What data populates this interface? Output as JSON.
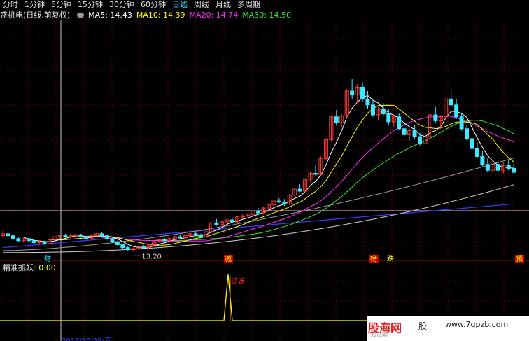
{
  "tabs": [
    "分时",
    "1分钟",
    "5分钟",
    "15分钟",
    "30分钟",
    "60分钟",
    "日线",
    "周线",
    "月线",
    "多周期"
  ],
  "active_tab": 6,
  "stock_title": "盛机电(日线,前复权)",
  "ma": {
    "ma5_label": "MA5:",
    "ma5_value": "14.43",
    "ma5_color": "#ffffff",
    "ma10_label": "MA10:",
    "ma10_value": "14.39",
    "ma10_color": "#ffff00",
    "ma20_label": "MA20:",
    "ma20_value": "14.74",
    "ma20_color": "#ff2cff",
    "ma30_label": "MA30:",
    "ma30_value": "14.50",
    "ma30_color": "#31e831"
  },
  "price_low_label": "13.20",
  "markers": [
    "财",
    "减",
    "榜",
    "跌",
    "预"
  ],
  "indicator": {
    "name": "精准抓妖",
    "value": ": 0.00",
    "signal_label": "抓妖"
  },
  "watermark": {
    "brand": "股海网",
    "brand2": "股",
    "url": "www.7gpzb.com",
    "sub": "股海网",
    "date": "2016/10/28/五"
  },
  "colors": {
    "up": "#ff3b3b",
    "down": "#3ee8ff",
    "grid": "#7a0000",
    "crosshair": "#c8c8c8"
  },
  "chart_data": {
    "type": "candlestick",
    "candles": [
      [
        14.8,
        15.3,
        14.6,
        15.0
      ],
      [
        15.0,
        15.2,
        14.7,
        14.8
      ],
      [
        14.8,
        14.9,
        14.4,
        14.5
      ],
      [
        14.5,
        14.7,
        14.2,
        14.3
      ],
      [
        14.3,
        14.6,
        14.1,
        14.5
      ],
      [
        14.5,
        14.6,
        14.2,
        14.3
      ],
      [
        14.3,
        14.4,
        14.0,
        14.1
      ],
      [
        14.1,
        14.3,
        13.9,
        14.2
      ],
      [
        14.2,
        14.3,
        13.9,
        14.0
      ],
      [
        14.0,
        14.5,
        13.9,
        14.4
      ],
      [
        14.4,
        14.8,
        14.3,
        14.7
      ],
      [
        14.7,
        14.9,
        14.5,
        14.8
      ],
      [
        14.8,
        15.0,
        14.6,
        14.7
      ],
      [
        14.7,
        14.9,
        14.5,
        14.8
      ],
      [
        14.8,
        15.0,
        14.6,
        14.9
      ],
      [
        14.9,
        15.0,
        14.6,
        14.7
      ],
      [
        14.7,
        14.8,
        14.4,
        14.5
      ],
      [
        14.5,
        14.9,
        14.4,
        14.8
      ],
      [
        14.8,
        15.1,
        14.7,
        15.0
      ],
      [
        15.0,
        15.2,
        14.7,
        14.8
      ],
      [
        14.8,
        14.9,
        14.4,
        14.5
      ],
      [
        14.5,
        14.6,
        14.1,
        14.2
      ],
      [
        14.2,
        14.3,
        13.8,
        13.9
      ],
      [
        13.9,
        14.0,
        13.5,
        13.6
      ],
      [
        13.6,
        13.8,
        13.3,
        13.4
      ],
      [
        13.4,
        13.6,
        13.2,
        13.5
      ],
      [
        13.5,
        13.8,
        13.4,
        13.7
      ],
      [
        13.7,
        13.9,
        13.5,
        13.6
      ],
      [
        13.6,
        14.0,
        13.5,
        13.9
      ],
      [
        13.9,
        14.3,
        13.8,
        14.2
      ],
      [
        14.2,
        14.5,
        14.1,
        14.4
      ],
      [
        14.4,
        14.6,
        14.2,
        14.3
      ],
      [
        14.3,
        14.6,
        14.2,
        14.5
      ],
      [
        14.5,
        14.8,
        14.4,
        14.7
      ],
      [
        14.7,
        14.9,
        14.5,
        14.6
      ],
      [
        14.6,
        14.9,
        14.5,
        14.8
      ],
      [
        14.8,
        15.1,
        14.7,
        15.0
      ],
      [
        15.0,
        15.2,
        14.8,
        14.9
      ],
      [
        14.9,
        15.0,
        14.6,
        14.7
      ],
      [
        14.7,
        15.3,
        14.6,
        15.2
      ],
      [
        15.2,
        16.2,
        15.1,
        16.1
      ],
      [
        16.1,
        16.5,
        15.8,
        15.9
      ],
      [
        15.9,
        16.3,
        15.7,
        16.2
      ],
      [
        16.2,
        16.6,
        16.0,
        16.4
      ],
      [
        16.4,
        16.7,
        16.1,
        16.2
      ],
      [
        16.2,
        16.8,
        16.1,
        16.7
      ],
      [
        16.7,
        17.0,
        16.5,
        16.8
      ],
      [
        16.8,
        17.1,
        16.6,
        16.9
      ],
      [
        16.9,
        17.4,
        16.8,
        17.3
      ],
      [
        17.3,
        17.6,
        17.0,
        17.1
      ],
      [
        17.1,
        17.7,
        17.0,
        17.6
      ],
      [
        17.6,
        18.0,
        17.4,
        17.9
      ],
      [
        17.9,
        18.4,
        17.7,
        18.3
      ],
      [
        18.3,
        18.6,
        18.1,
        18.2
      ],
      [
        18.2,
        18.5,
        17.8,
        18.0
      ],
      [
        18.0,
        19.0,
        17.9,
        18.9
      ],
      [
        18.9,
        19.6,
        18.7,
        19.5
      ],
      [
        19.5,
        20.0,
        19.2,
        19.3
      ],
      [
        19.3,
        20.6,
        19.2,
        20.5
      ],
      [
        20.5,
        21.2,
        20.2,
        21.1
      ],
      [
        21.1,
        21.9,
        20.8,
        21.0
      ],
      [
        21.0,
        22.8,
        20.9,
        22.6
      ],
      [
        22.6,
        24.6,
        22.4,
        24.5
      ],
      [
        24.5,
        26.9,
        24.3,
        26.8
      ],
      [
        26.8,
        27.5,
        25.9,
        26.2
      ],
      [
        26.2,
        27.1,
        25.8,
        26.9
      ],
      [
        26.9,
        29.6,
        26.7,
        29.4
      ],
      [
        29.4,
        30.6,
        28.6,
        29.0
      ],
      [
        29.0,
        30.1,
        28.2,
        29.8
      ],
      [
        29.8,
        30.3,
        28.3,
        28.6
      ],
      [
        28.6,
        29.4,
        27.6,
        28.0
      ],
      [
        28.0,
        28.5,
        26.8,
        27.0
      ],
      [
        27.0,
        27.8,
        26.4,
        27.6
      ],
      [
        27.6,
        28.2,
        26.9,
        27.1
      ],
      [
        27.1,
        27.6,
        26.0,
        26.3
      ],
      [
        26.3,
        27.0,
        25.8,
        26.8
      ],
      [
        26.8,
        27.2,
        25.5,
        25.6
      ],
      [
        25.6,
        26.2,
        24.8,
        25.0
      ],
      [
        25.0,
        25.6,
        24.4,
        25.4
      ],
      [
        25.4,
        26.0,
        24.6,
        24.8
      ],
      [
        24.8,
        25.2,
        23.9,
        24.1
      ],
      [
        24.1,
        25.0,
        23.8,
        24.8
      ],
      [
        24.8,
        27.2,
        24.6,
        27.0
      ],
      [
        27.0,
        27.8,
        26.2,
        26.4
      ],
      [
        26.4,
        27.0,
        25.6,
        26.8
      ],
      [
        26.8,
        28.8,
        26.6,
        28.6
      ],
      [
        28.6,
        29.6,
        27.8,
        28.0
      ],
      [
        28.0,
        28.6,
        26.6,
        26.8
      ],
      [
        26.8,
        27.2,
        25.4,
        25.6
      ],
      [
        25.6,
        26.0,
        24.4,
        24.6
      ],
      [
        24.6,
        25.0,
        23.4,
        23.6
      ],
      [
        23.6,
        24.2,
        22.6,
        22.8
      ],
      [
        22.8,
        23.4,
        21.8,
        22.0
      ],
      [
        22.0,
        22.6,
        21.2,
        21.4
      ],
      [
        21.4,
        22.2,
        21.0,
        22.0
      ],
      [
        22.0,
        22.4,
        21.2,
        21.4
      ],
      [
        21.4,
        22.2,
        21.0,
        21.9
      ],
      [
        21.9,
        22.4,
        21.4,
        21.6
      ],
      [
        21.6,
        22.0,
        21.0,
        21.2
      ]
    ],
    "ma5_color": "#ffffff",
    "ma10_color": "#ffff00",
    "ma20_color": "#ff2cff",
    "ma30_color": "#31e831",
    "long_ma_colors": [
      "#9a9a9a",
      "#3a3aff",
      "#cfcfcf"
    ],
    "signal_index": 38,
    "signal_value": 1,
    "indicator_value": 0
  }
}
